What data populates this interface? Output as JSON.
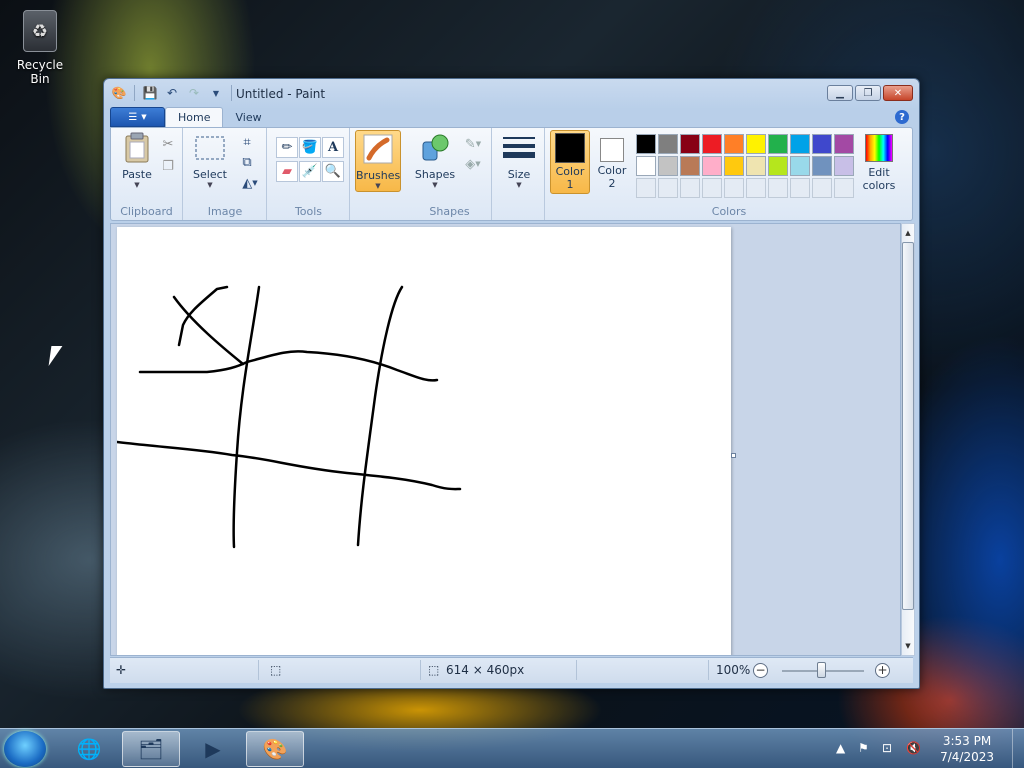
{
  "desktop": {
    "recycle_bin_label": "Recycle Bin"
  },
  "window": {
    "title": "Untitled - Paint",
    "tabs": [
      "Home",
      "View"
    ],
    "ribbon": {
      "clipboard": {
        "label": "Clipboard",
        "paste": "Paste"
      },
      "image": {
        "label": "Image",
        "select": "Select"
      },
      "tools": {
        "label": "Tools"
      },
      "brushes": "Brushes",
      "shapes": {
        "label": "Shapes",
        "button": "Shapes"
      },
      "size": "Size",
      "colors": {
        "label": "Colors",
        "color1": "Color",
        "color1_num": "1",
        "color2": "Color",
        "color2_num": "2",
        "edit": "Edit",
        "edit2": "colors",
        "color1_value": "#000000",
        "color2_value": "#ffffff",
        "palette_row1": [
          "#000000",
          "#7f7f7f",
          "#880015",
          "#ed1c24",
          "#ff7f27",
          "#fff200",
          "#22b14c",
          "#00a2e8",
          "#3f48cc",
          "#a349a4"
        ],
        "palette_row2": [
          "#ffffff",
          "#c3c3c3",
          "#b97a57",
          "#ffaec9",
          "#ffc90e",
          "#efe4b0",
          "#b5e61d",
          "#99d9ea",
          "#7092be",
          "#c8bfe7"
        ]
      }
    },
    "status": {
      "dimensions": "614 × 460px",
      "zoom": "100%"
    }
  },
  "taskbar": {
    "time": "3:53 PM",
    "date": "7/4/2023"
  }
}
